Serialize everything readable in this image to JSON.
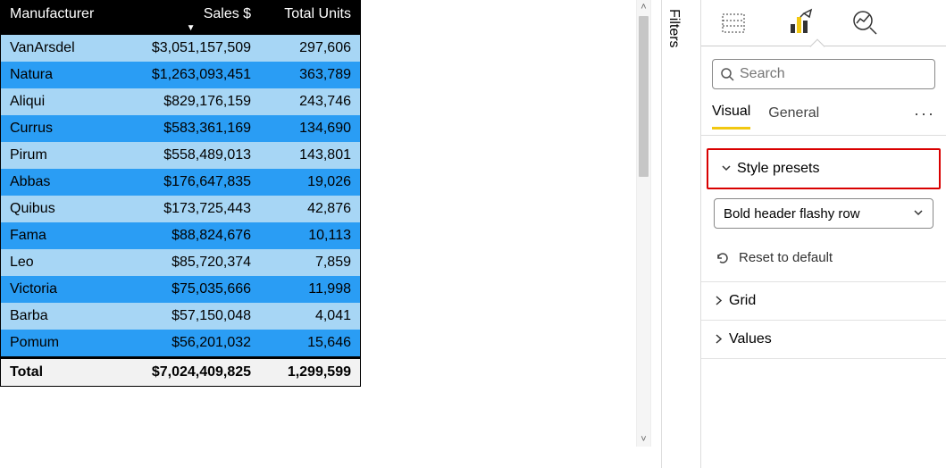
{
  "table": {
    "columns": [
      "Manufacturer",
      "Sales $",
      "Total Units"
    ],
    "sortColumnIndex": 1,
    "sortDirection": "desc",
    "rows": [
      {
        "manufacturer": "VanArsdel",
        "sales": "$3,051,157,509",
        "units": "297,606"
      },
      {
        "manufacturer": "Natura",
        "sales": "$1,263,093,451",
        "units": "363,789"
      },
      {
        "manufacturer": "Aliqui",
        "sales": "$829,176,159",
        "units": "243,746"
      },
      {
        "manufacturer": "Currus",
        "sales": "$583,361,169",
        "units": "134,690"
      },
      {
        "manufacturer": "Pirum",
        "sales": "$558,489,013",
        "units": "143,801"
      },
      {
        "manufacturer": "Abbas",
        "sales": "$176,647,835",
        "units": "19,026"
      },
      {
        "manufacturer": "Quibus",
        "sales": "$173,725,443",
        "units": "42,876"
      },
      {
        "manufacturer": "Fama",
        "sales": "$88,824,676",
        "units": "10,113"
      },
      {
        "manufacturer": "Leo",
        "sales": "$85,720,374",
        "units": "7,859"
      },
      {
        "manufacturer": "Victoria",
        "sales": "$75,035,666",
        "units": "11,998"
      },
      {
        "manufacturer": "Barba",
        "sales": "$57,150,048",
        "units": "4,041"
      },
      {
        "manufacturer": "Pomum",
        "sales": "$56,201,032",
        "units": "15,646"
      }
    ],
    "total": {
      "label": "Total",
      "sales": "$7,024,409,825",
      "units": "1,299,599"
    }
  },
  "filters": {
    "label": "Filters"
  },
  "format": {
    "searchPlaceholder": "Search",
    "tabs": {
      "visual": "Visual",
      "general": "General"
    },
    "sections": {
      "stylePresets": {
        "label": "Style presets",
        "value": "Bold header flashy row"
      },
      "reset": "Reset to default",
      "grid": "Grid",
      "values": "Values"
    }
  },
  "chart_data": {
    "type": "table",
    "title": "",
    "columns": [
      "Manufacturer",
      "Sales $",
      "Total Units"
    ],
    "rows": [
      [
        "VanArsdel",
        3051157509,
        297606
      ],
      [
        "Natura",
        1263093451,
        363789
      ],
      [
        "Aliqui",
        829176159,
        243746
      ],
      [
        "Currus",
        583361169,
        134690
      ],
      [
        "Pirum",
        558489013,
        143801
      ],
      [
        "Abbas",
        176647835,
        19026
      ],
      [
        "Quibus",
        173725443,
        42876
      ],
      [
        "Fama",
        88824676,
        10113
      ],
      [
        "Leo",
        85720374,
        7859
      ],
      [
        "Victoria",
        75035666,
        11998
      ],
      [
        "Barba",
        57150048,
        4041
      ],
      [
        "Pomum",
        56201032,
        15646
      ]
    ],
    "totals": {
      "Sales $": 7024409825,
      "Total Units": 1299599
    }
  }
}
